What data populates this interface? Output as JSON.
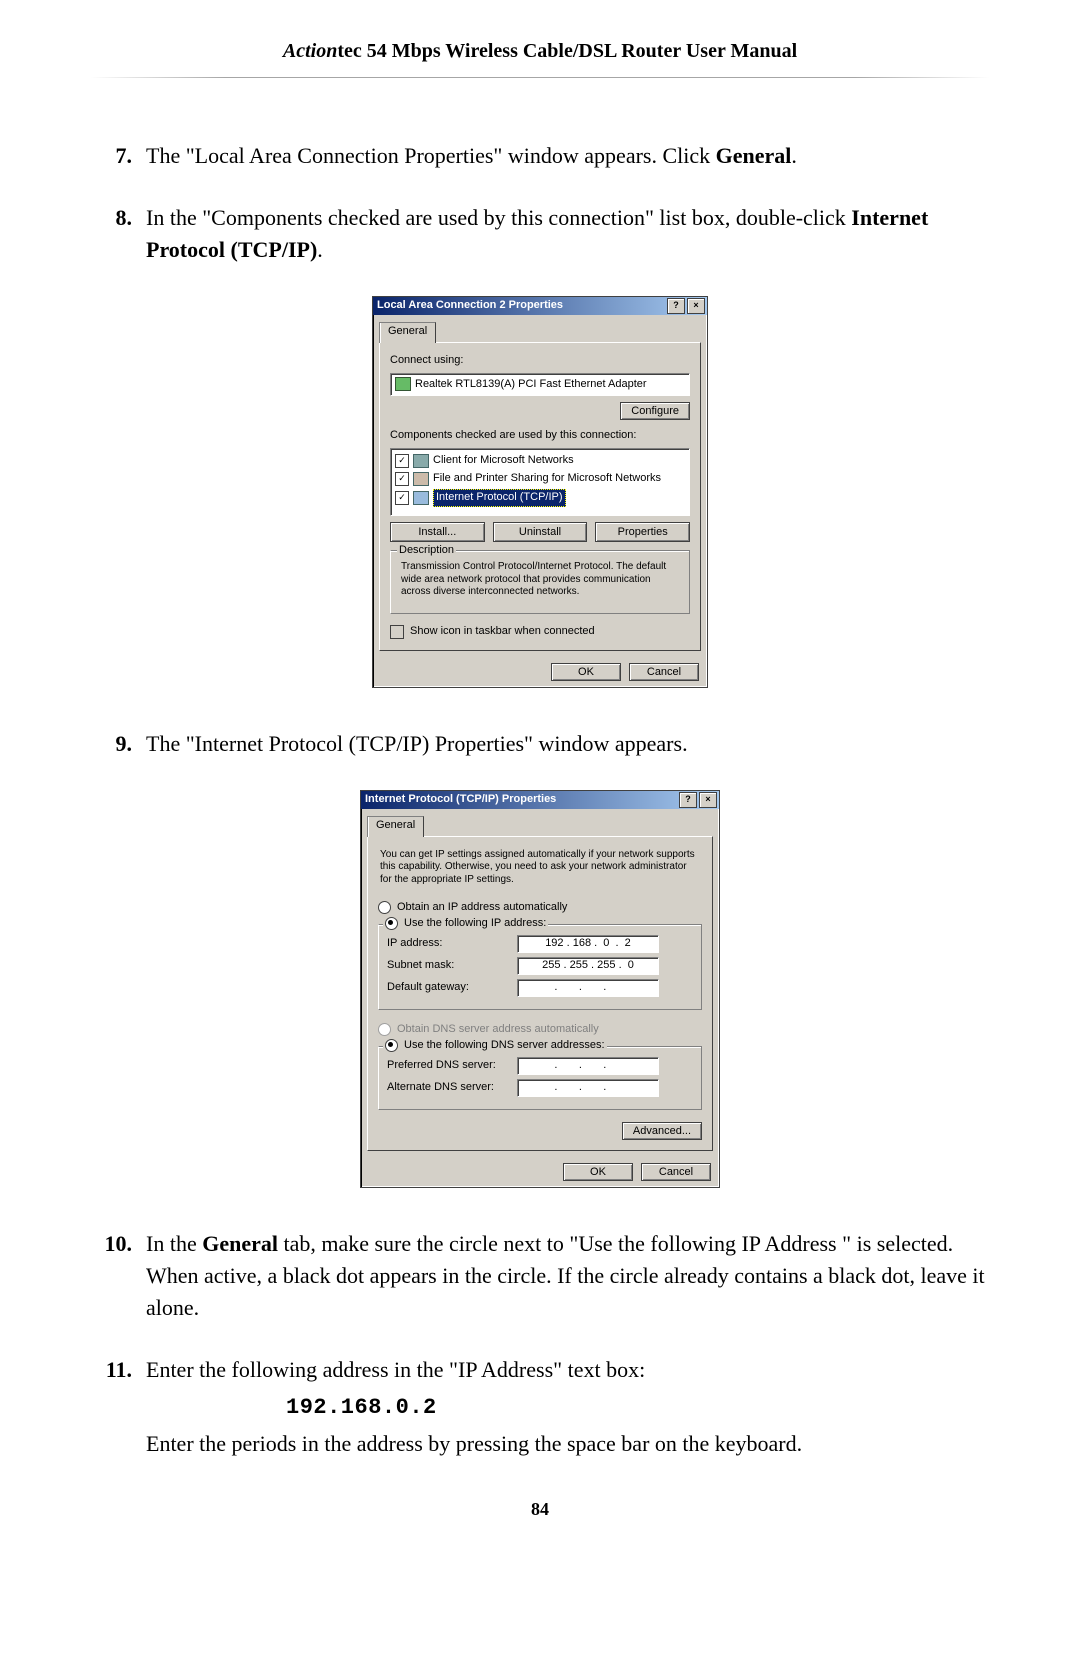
{
  "header": {
    "brand_italic": "Action",
    "brand_rest": "tec 54 Mbps Wireless Cable/DSL Router User Manual"
  },
  "steps": {
    "s7": {
      "num": "7.",
      "text_a": "The \"Local Area Connection Properties\" window appears. Click ",
      "bold": "General",
      "text_b": "."
    },
    "s8": {
      "num": "8.",
      "text_a": "In the \"Components checked are used by this connection\" list box, double-click ",
      "bold": "Internet Protocol (TCP/IP)",
      "text_b": "."
    },
    "s9": {
      "num": "9.",
      "text": "The \"Internet Protocol (TCP/IP) Properties\" window appears."
    },
    "s10": {
      "num": "10.",
      "text_a": "In the ",
      "bold": "General",
      "text_b": " tab, make sure the circle next to \"Use the following IP Address \" is selected. When active, a black dot appears in the circle. If the circle already contains a black dot, leave it alone."
    },
    "s11": {
      "num": "11.",
      "text_a": "Enter the following address in the \"IP Address\" text box:",
      "ip": "192.168.0.2",
      "text_b": "Enter the periods in the address by pressing the space bar on the keyboard."
    }
  },
  "dlg1": {
    "title": "Local Area Connection 2 Properties",
    "help_btn": "?",
    "close_btn": "×",
    "tab": "General",
    "connect_using_label": "Connect using:",
    "adapter_text": "Realtek RTL8139(A) PCI Fast Ethernet Adapter",
    "configure_btn": "Configure",
    "components_label": "Components checked are used by this connection:",
    "comp1": "Client for Microsoft Networks",
    "comp2": "File and Printer Sharing for Microsoft Networks",
    "comp3": "Internet Protocol (TCP/IP)",
    "install_btn": "Install...",
    "uninstall_btn": "Uninstall",
    "properties_btn": "Properties",
    "desc_title": "Description",
    "desc_text": "Transmission Control Protocol/Internet Protocol. The default wide area network protocol that provides communication across diverse interconnected networks.",
    "show_icon": "Show icon in taskbar when connected",
    "ok": "OK",
    "cancel": "Cancel"
  },
  "dlg2": {
    "title": "Internet Protocol (TCP/IP) Properties",
    "help_btn": "?",
    "close_btn": "×",
    "tab": "General",
    "intro": "You can get IP settings assigned automatically if your network supports this capability. Otherwise, you need to ask your network administrator for the appropriate IP settings.",
    "r1": "Obtain an IP address automatically",
    "r2": "Use the following IP address:",
    "ip_label": "IP address:",
    "ip_value": "192 . 168 .  0  .  2",
    "subnet_label": "Subnet mask:",
    "subnet_value": "255 . 255 . 255 .  0",
    "gateway_label": "Default gateway:",
    "gateway_value": " .       .       .      ",
    "r3": "Obtain DNS server address automatically",
    "r4": "Use the following DNS server addresses:",
    "pdns_label": "Preferred DNS server:",
    "pdns_value": " .       .       .      ",
    "adns_label": "Alternate DNS server:",
    "adns_value": " .       .       .      ",
    "advanced": "Advanced...",
    "ok": "OK",
    "cancel": "Cancel"
  },
  "page_number": "84"
}
